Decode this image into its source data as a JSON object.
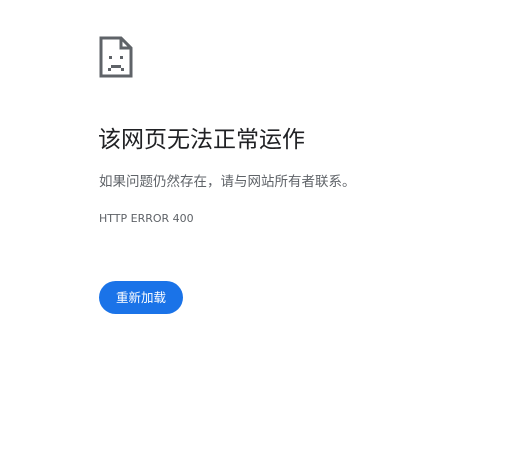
{
  "error_page": {
    "icon": "sad-page-icon",
    "title": "该网页无法正常运作",
    "message": "如果问题仍然存在，请与网站所有者联系。",
    "error_code": "HTTP ERROR 400",
    "reload_label": "重新加载"
  },
  "colors": {
    "button": "#1a73e8",
    "title": "#202124",
    "text": "#5f6368",
    "icon": "#5f6368"
  }
}
